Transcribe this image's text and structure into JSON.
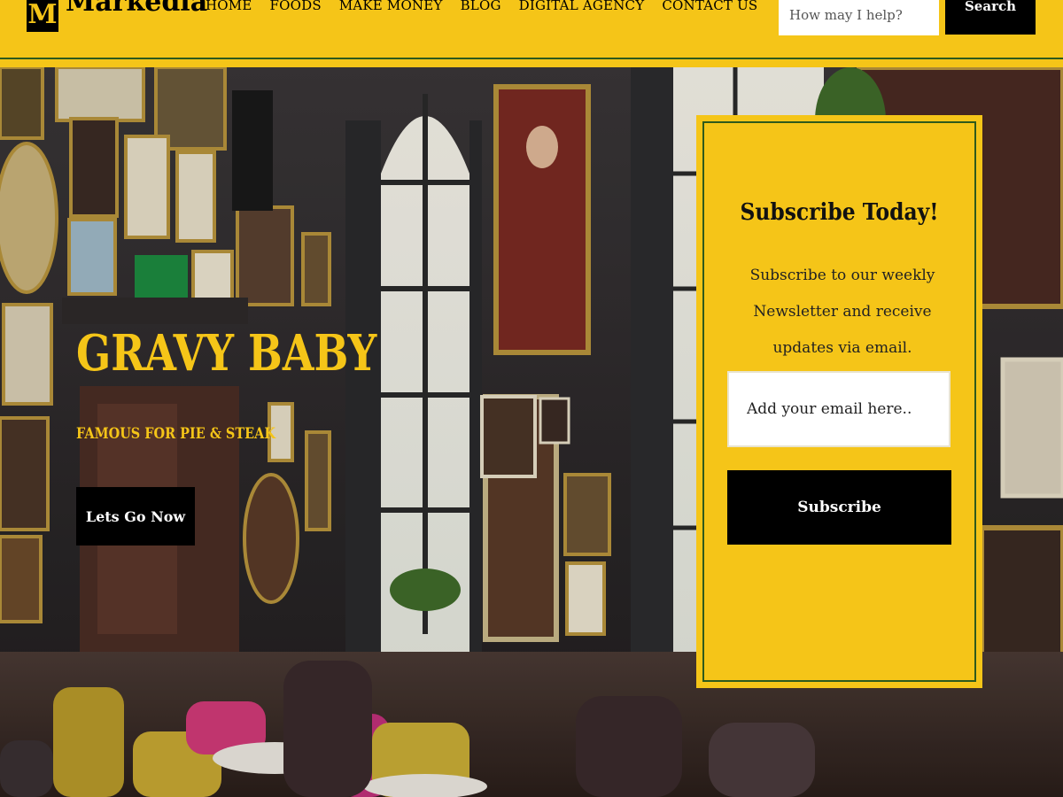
{
  "brand": {
    "logo_letter": "M",
    "name": "Markedia"
  },
  "nav": {
    "items": [
      {
        "label": "HOME"
      },
      {
        "label": "FOODS"
      },
      {
        "label": "MAKE MONEY"
      },
      {
        "label": "BLOG"
      },
      {
        "label": "DIGITAL AGENCY"
      },
      {
        "label": "CONTACT US"
      }
    ]
  },
  "search": {
    "placeholder": "How may I help?",
    "button_label": "Search"
  },
  "hero": {
    "title": "GRAVY BABY",
    "subtitle": "FAMOUS FOR PIE & STEAK",
    "cta_label": "Lets Go Now",
    "background_scene": "restaurant-interior-with-gallery-wall"
  },
  "subscribe": {
    "title": "Subscribe Today!",
    "text": "Subscribe to our weekly Newsletter and receive updates via email.",
    "email_placeholder": "Add your email here..",
    "button_label": "Subscribe"
  },
  "colors": {
    "accent": "#f5c518",
    "dark": "#000000",
    "rule": "#2e5a1c"
  },
  "icons": [
    "logo-m-icon"
  ]
}
